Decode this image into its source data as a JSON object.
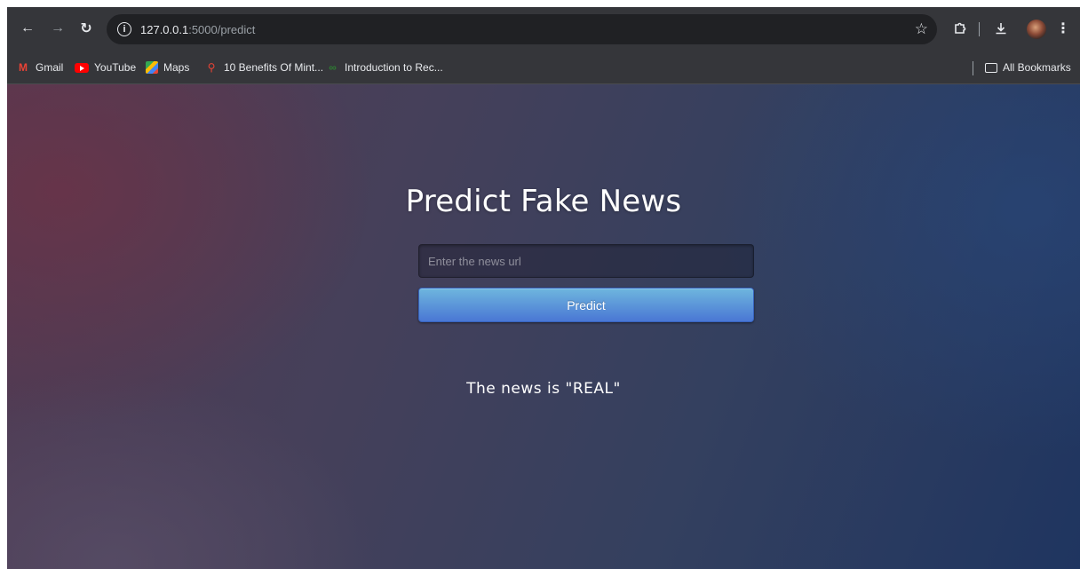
{
  "browser": {
    "url_host": "127.0.0.1",
    "url_path": ":5000/predict",
    "icons": {
      "back": "back-arrow-icon",
      "forward": "forward-arrow-icon",
      "reload": "reload-icon",
      "site_info": "info-icon",
      "bookmark_star": "star-icon",
      "extensions": "puzzle-icon",
      "downloads": "download-icon",
      "menu": "kebab-menu-icon"
    }
  },
  "bookmarks": {
    "items": [
      {
        "label": "Gmail",
        "icon": "gmail-icon"
      },
      {
        "label": "YouTube",
        "icon": "youtube-icon"
      },
      {
        "label": "Maps",
        "icon": "maps-icon"
      },
      {
        "label": "10 Benefits Of Mint...",
        "icon": "location-pin-icon"
      },
      {
        "label": "Introduction to Rec...",
        "icon": "link-icon"
      }
    ],
    "all_bookmarks": "All Bookmarks"
  },
  "page": {
    "title": "Predict Fake News",
    "input_placeholder": "Enter the news url",
    "button_label": "Predict",
    "result_text": "The news is \"REAL\""
  },
  "colors": {
    "button_top": "#6eb6de",
    "button_bottom": "#4a77d4",
    "browser_chrome": "#35363a"
  }
}
